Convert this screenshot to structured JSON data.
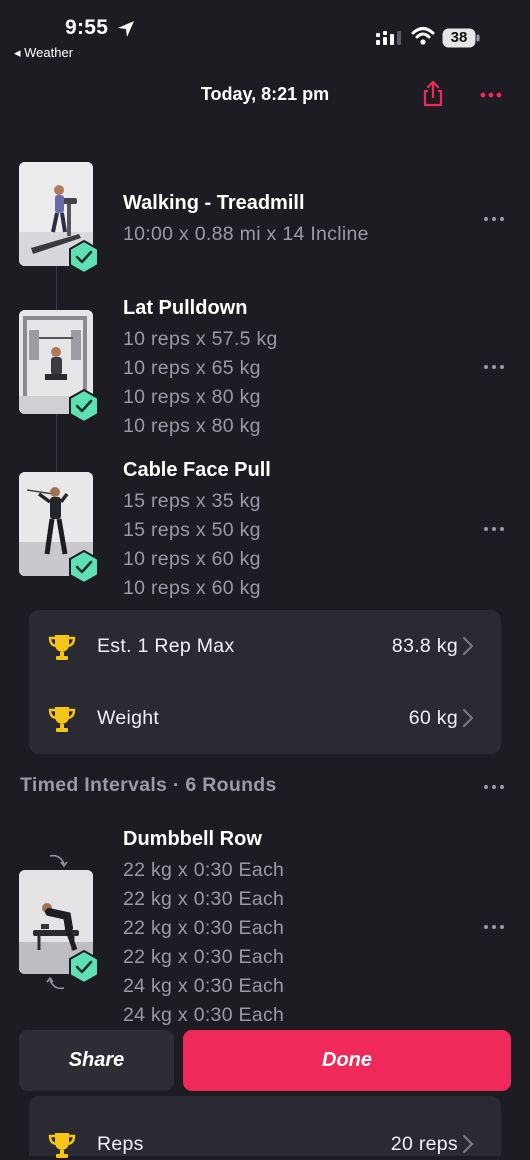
{
  "status_bar": {
    "time": "9:55",
    "back_app": "◂ Weather",
    "battery": "38"
  },
  "header": {
    "title": "Today, 8:21 pm"
  },
  "exercises": [
    {
      "name": "Walking - Treadmill",
      "sets": [
        "10:00 x 0.88 mi x 14 Incline"
      ]
    },
    {
      "name": "Lat Pulldown",
      "sets": [
        "10 reps x 57.5 kg",
        "10 reps x 65 kg",
        "10 reps x 80 kg",
        "10 reps x 80 kg"
      ]
    },
    {
      "name": "Cable Face Pull",
      "sets": [
        "15 reps x 35 kg",
        "15 reps x 50 kg",
        "10 reps x 60 kg",
        "10 reps x 60 kg"
      ]
    }
  ],
  "records": [
    {
      "label": "Est. 1 Rep Max",
      "value": "83.8 kg"
    },
    {
      "label": "Weight",
      "value": "60 kg"
    }
  ],
  "section": {
    "title": "Timed Intervals · 6 Rounds"
  },
  "interval_exercise": {
    "name": "Dumbbell Row",
    "sets": [
      "22 kg x 0:30 Each",
      "22 kg x 0:30 Each",
      "22 kg x 0:30 Each",
      "22 kg x 0:30 Each",
      "24 kg x 0:30 Each",
      "24 kg x 0:30 Each"
    ]
  },
  "partial_record": {
    "label": "Reps",
    "value": "20 reps"
  },
  "buttons": {
    "share": "Share",
    "done": "Done"
  },
  "colors": {
    "background": "#1c1c22",
    "accent": "#f0295b",
    "check": "#5ee0b4",
    "trophy": "#f5c518",
    "muted_text": "#9a9aa6",
    "card": "#2a2a33"
  },
  "icons": [
    "location-arrow-icon",
    "signal-icon",
    "wifi-icon",
    "battery-icon",
    "share-icon",
    "more-icon",
    "check-icon",
    "trophy-icon",
    "chevron-right-icon",
    "cycle-arrows-icon"
  ]
}
